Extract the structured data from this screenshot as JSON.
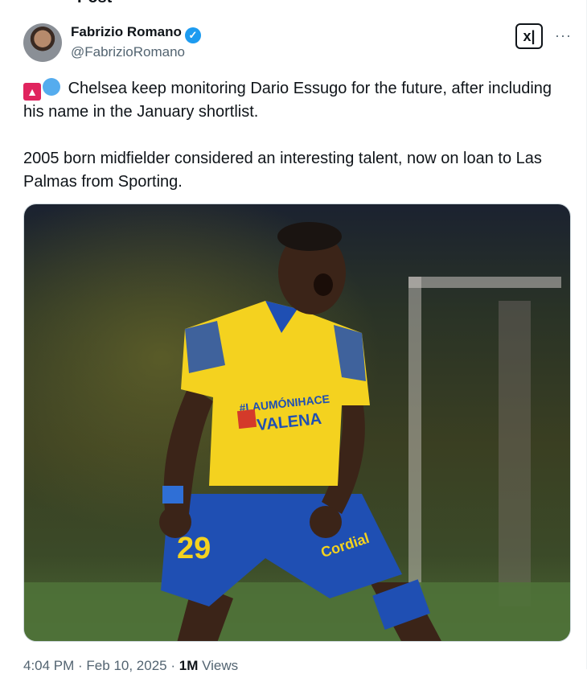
{
  "header": {
    "back_icon": "arrow-left-icon",
    "title": "Post"
  },
  "author": {
    "name": "Fabrizio Romano",
    "handle": "@FabrizioRomano",
    "verified_icon": "verified-badge-icon",
    "badge_color": "#1d9bf0"
  },
  "actions": {
    "grok_label": "x|",
    "grok_icon": "grok-icon",
    "more_icon": "more-icon",
    "more_label": "···"
  },
  "post": {
    "emoji_1": "siren-emoji",
    "emoji_2": "blue-circle-emoji",
    "paragraph_1": "Chelsea keep monitoring Dario Essugo for the future, after including his name in the January shortlist.",
    "paragraph_2": "2005 born midfielder considered an interesting talent, now on loan to Las Palmas from Sporting."
  },
  "media": {
    "description_icon": "photo-icon",
    "jersey_text_1": "#LAUMÓNIHACE",
    "jersey_text_2": "VALENA",
    "shorts_number": "29",
    "shorts_sponsor": "Cordial",
    "colors": {
      "shirt": "#f4d21f",
      "shorts": "#1f4fb3",
      "background": "#2c3520"
    }
  },
  "meta": {
    "time": "4:04 PM",
    "sep1": " · ",
    "date": "Feb 10, 2025",
    "sep2": " · ",
    "views_count": "1M",
    "views_label": " Views"
  }
}
